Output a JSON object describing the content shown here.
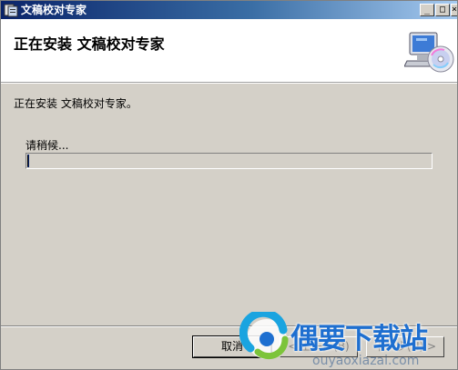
{
  "window": {
    "title": "文稿校对专家",
    "controls": {
      "minimize": "_",
      "maximize": "□",
      "close": "×"
    }
  },
  "header": {
    "title": "正在安装 文稿校对专家"
  },
  "body": {
    "status": "正在安装 文稿校对专家。",
    "wait_label": "请稍候...",
    "progress": 0.005
  },
  "buttons": {
    "cancel": "取消",
    "prev": "< 上一步(B)",
    "next": "下一步(N) >"
  },
  "watermark": {
    "brand": "偶要下载站",
    "url": "ouyaoxiazai.com"
  },
  "colors": {
    "title_bar": "#0a246a",
    "dialog_bg": "#d4d0c8",
    "watermark": "#1e6fd0"
  },
  "icons": {
    "app": "installer-icon",
    "header": "computer-cd-icon"
  }
}
